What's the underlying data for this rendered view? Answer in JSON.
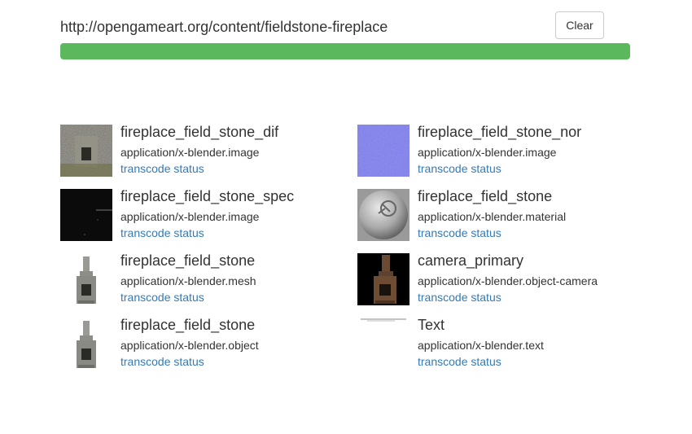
{
  "header": {
    "url": "http://opengameart.org/content/fieldstone-fireplace",
    "clear_label": "Clear",
    "progress": 1.0,
    "progress_color": "#5cb85c"
  },
  "items": [
    {
      "title": "fireplace_field_stone_dif",
      "type": "application/x-blender.image",
      "link": "transcode status",
      "thumb": "stone-texture-thumbnail"
    },
    {
      "title": "fireplace_field_stone_nor",
      "type": "application/x-blender.image",
      "link": "transcode status",
      "thumb": "normal-map-thumbnail"
    },
    {
      "title": "fireplace_field_stone_spec",
      "type": "application/x-blender.image",
      "link": "transcode status",
      "thumb": "specular-map-thumbnail"
    },
    {
      "title": "fireplace_field_stone",
      "type": "application/x-blender.material",
      "link": "transcode status",
      "thumb": "material-sphere-thumbnail"
    },
    {
      "title": "fireplace_field_stone",
      "type": "application/x-blender.mesh",
      "link": "transcode status",
      "thumb": "fireplace-mesh-thumbnail"
    },
    {
      "title": "camera_primary",
      "type": "application/x-blender.object-camera",
      "link": "transcode status",
      "thumb": "camera-render-thumbnail"
    },
    {
      "title": "fireplace_field_stone",
      "type": "application/x-blender.object",
      "link": "transcode status",
      "thumb": "fireplace-object-thumbnail"
    },
    {
      "title": "Text",
      "type": "application/x-blender.text",
      "link": "transcode status",
      "thumb": "text-thumbnail"
    }
  ]
}
